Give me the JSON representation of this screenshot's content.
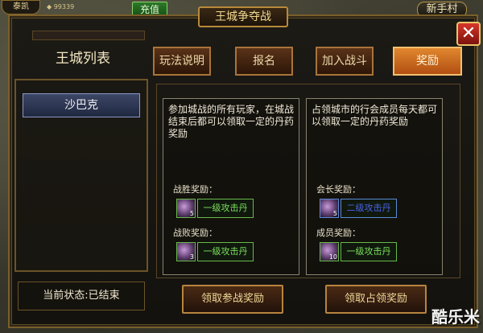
{
  "hud": {
    "name": "泰凯",
    "gold": "99339",
    "recharge": "充值",
    "newbie": "新手村"
  },
  "panel": {
    "title": "王城争夺战",
    "close": "✕"
  },
  "left": {
    "title": "王城列表",
    "cities": [
      "沙巴克"
    ],
    "status": "当前状态:已结束"
  },
  "tabs": [
    {
      "label": "玩法说明",
      "active": false
    },
    {
      "label": "报名",
      "active": false
    },
    {
      "label": "加入战斗",
      "active": false
    },
    {
      "label": "奖励",
      "active": true
    }
  ],
  "participants": {
    "desc": "参加城战的所有玩家，在城战结束后都可以领取一定的丹药奖励",
    "win_label": "战胜奖励：",
    "win_item": {
      "count": "5",
      "name": "一级攻击丹",
      "rarity": "green"
    },
    "lose_label": "战败奖励：",
    "lose_item": {
      "count": "3",
      "name": "一级攻击丹",
      "rarity": "green"
    }
  },
  "owners": {
    "desc": "占领城市的行会成员每天都可以领取一定的丹药奖励",
    "leader_label": "会长奖励：",
    "leader_item": {
      "count": "5",
      "name": "二级攻击丹",
      "rarity": "blue"
    },
    "member_label": "成员奖励：",
    "member_item": {
      "count": "10",
      "name": "一级攻击丹",
      "rarity": "green"
    }
  },
  "buttons": {
    "claim_participation": "领取参战奖励",
    "claim_occupation": "领取占领奖励"
  },
  "watermark": "酷乐米",
  "colors": {
    "green_item": "#7be05a",
    "blue_item": "#4a62e8",
    "active_tab": "#e0872e",
    "close": "#d8362a"
  }
}
